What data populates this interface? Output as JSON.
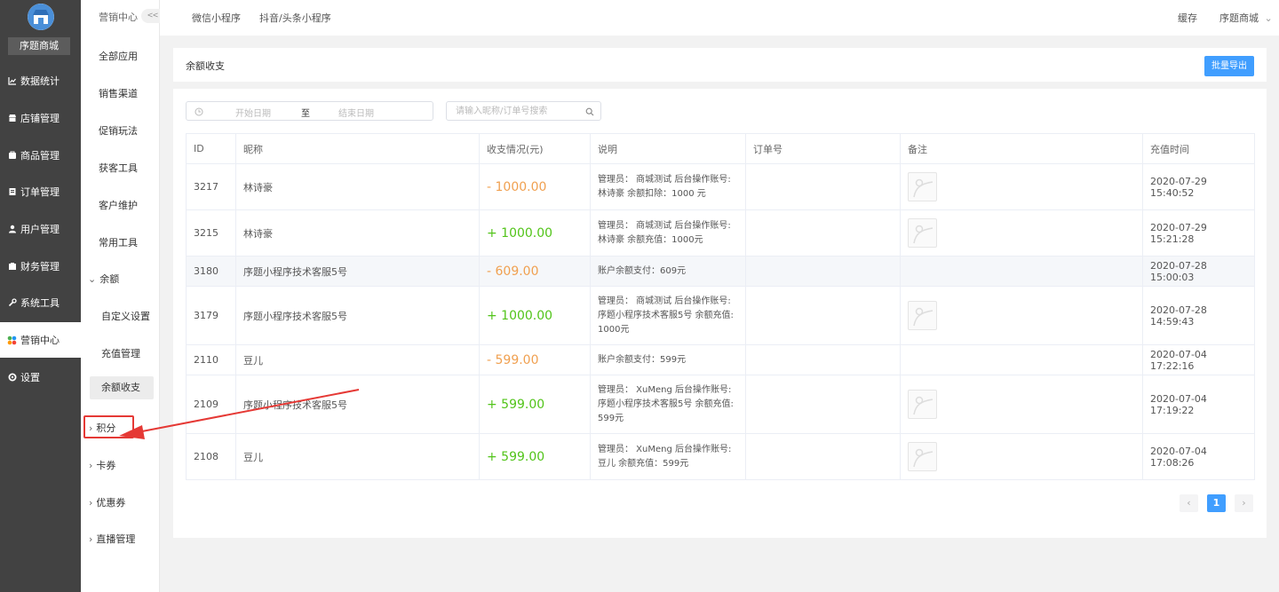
{
  "nav": {
    "shop_name": "序题商城",
    "items": [
      {
        "label": "数据统计",
        "icon": "chart-icon"
      },
      {
        "label": "店铺管理",
        "icon": "store-icon"
      },
      {
        "label": "商品管理",
        "icon": "goods-icon"
      },
      {
        "label": "订单管理",
        "icon": "order-icon"
      },
      {
        "label": "用户管理",
        "icon": "user-icon"
      },
      {
        "label": "财务管理",
        "icon": "finance-icon"
      },
      {
        "label": "系统工具",
        "icon": "wrench-icon"
      },
      {
        "label": "营销中心",
        "icon": "marketing-icon"
      },
      {
        "label": "设置",
        "icon": "settings-icon"
      }
    ],
    "active": "营销中心"
  },
  "submenu": {
    "header": "营销中心",
    "collapse": "<<",
    "items": [
      "全部应用",
      "销售渠道",
      "促销玩法",
      "获客工具",
      "客户维护",
      "常用工具"
    ],
    "balance_group": "余额",
    "balance_children": [
      "自定义设置",
      "充值管理",
      "余额收支"
    ],
    "groups": [
      "积分",
      "卡券",
      "优惠券",
      "直播管理"
    ]
  },
  "topbar": {
    "tabs": [
      "微信小程序",
      "抖音/头条小程序"
    ],
    "cache": "缓存",
    "shop": "序题商城"
  },
  "page": {
    "title": "余额收支",
    "export_label": "批量导出",
    "date_start_placeholder": "开始日期",
    "date_sep": "至",
    "date_end_placeholder": "结束日期",
    "search_placeholder": "请输入昵称/订单号搜索"
  },
  "table": {
    "headers": [
      "ID",
      "昵称",
      "收支情况(元)",
      "说明",
      "订单号",
      "备注",
      "充值时间"
    ],
    "rows": [
      {
        "id": "3217",
        "nickname": "林诗豪",
        "amount": "- 1000.00",
        "sign": "neg",
        "desc": "管理员： 商城测试 后台操作账号: 林诗豪 余额扣除：1000 元",
        "order": "",
        "has_img": true,
        "time": "2020-07-29 15:40:52"
      },
      {
        "id": "3215",
        "nickname": "林诗豪",
        "amount": "+ 1000.00",
        "sign": "pos",
        "desc": "管理员： 商城测试 后台操作账号: 林诗豪 余额充值：1000元",
        "order": "",
        "has_img": true,
        "time": "2020-07-29 15:21:28"
      },
      {
        "id": "3180",
        "nickname": "序题小程序技术客服5号",
        "amount": "- 609.00",
        "sign": "neg",
        "desc": "账户余额支付：609元",
        "order": "",
        "has_img": false,
        "time": "2020-07-28 15:00:03"
      },
      {
        "id": "3179",
        "nickname": "序题小程序技术客服5号",
        "amount": "+ 1000.00",
        "sign": "pos",
        "desc": "管理员： 商城测试 后台操作账号: 序题小程序技术客服5号 余额充值: 1000元",
        "order": "",
        "has_img": true,
        "time": "2020-07-28 14:59:43"
      },
      {
        "id": "2110",
        "nickname": "豆儿",
        "amount": "- 599.00",
        "sign": "neg",
        "desc": "账户余额支付：599元",
        "order": "",
        "has_img": false,
        "time": "2020-07-04 17:22:16"
      },
      {
        "id": "2109",
        "nickname": "序题小程序技术客服5号",
        "amount": "+ 599.00",
        "sign": "pos",
        "desc": "管理员： XuMeng 后台操作账号: 序题小程序技术客服5号 余额充值: 599元",
        "order": "",
        "has_img": true,
        "time": "2020-07-04 17:19:22"
      },
      {
        "id": "2108",
        "nickname": "豆儿",
        "amount": "+ 599.00",
        "sign": "pos",
        "desc": "管理员： XuMeng 后台操作账号: 豆儿 余额充值：599元",
        "order": "",
        "has_img": true,
        "time": "2020-07-04 17:08:26"
      }
    ]
  },
  "pagination": {
    "prev": "‹",
    "current": "1",
    "next": "›"
  },
  "colors": {
    "accent": "#409eff",
    "negative": "#f0a050",
    "positive": "#52c41a",
    "nav_bg": "#424242",
    "annotation": "#e53935"
  }
}
